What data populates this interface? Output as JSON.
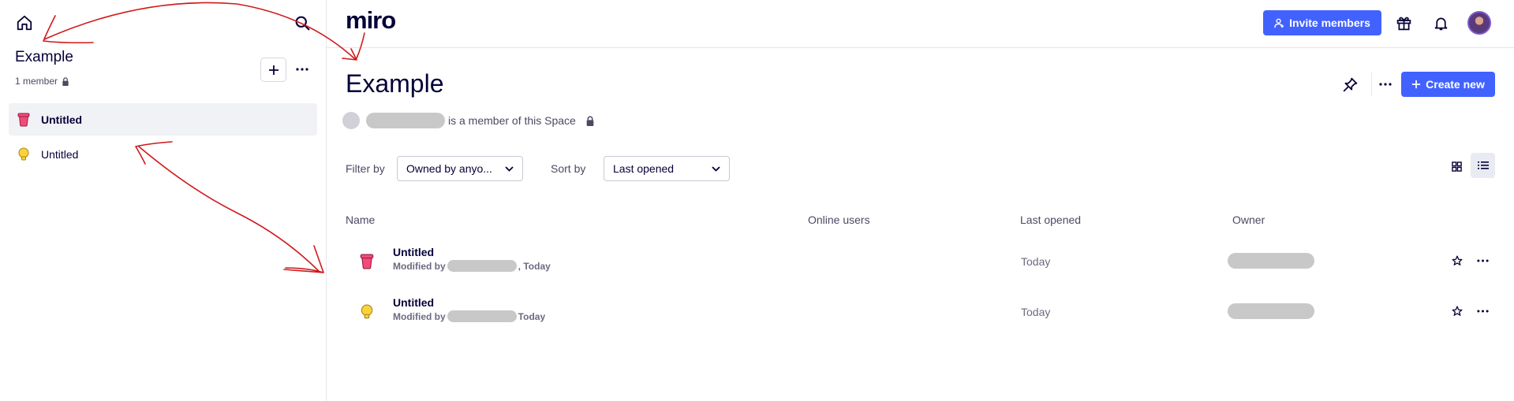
{
  "sidebar": {
    "space_title": "Example",
    "members_label": "1 member",
    "boards": [
      {
        "label": "Untitled",
        "icon": "pink-bucket-icon",
        "active": true
      },
      {
        "label": "Untitled",
        "icon": "lightbulb-icon",
        "active": false
      }
    ]
  },
  "header": {
    "logo": "miro",
    "invite_label": "Invite members"
  },
  "main": {
    "title": "Example",
    "member_text": "is a member of this Space",
    "create_label": "Create new",
    "filter_label": "Filter by",
    "filter_value": "Owned by anyo...",
    "sort_label": "Sort by",
    "sort_value": "Last opened"
  },
  "table": {
    "columns": {
      "name": "Name",
      "online": "Online users",
      "last_opened": "Last opened",
      "owner": "Owner"
    },
    "rows": [
      {
        "name": "Untitled",
        "modified_prefix": "Modified by",
        "modified_suffix": ", Today",
        "last_opened": "Today",
        "icon": "pink-bucket-icon"
      },
      {
        "name": "Untitled",
        "modified_prefix": "Modified by",
        "modified_suffix": "Today",
        "last_opened": "Today",
        "icon": "lightbulb-icon"
      }
    ]
  },
  "colors": {
    "accent": "#4262ff",
    "text": "#050038",
    "annotation": "#d0191b"
  }
}
